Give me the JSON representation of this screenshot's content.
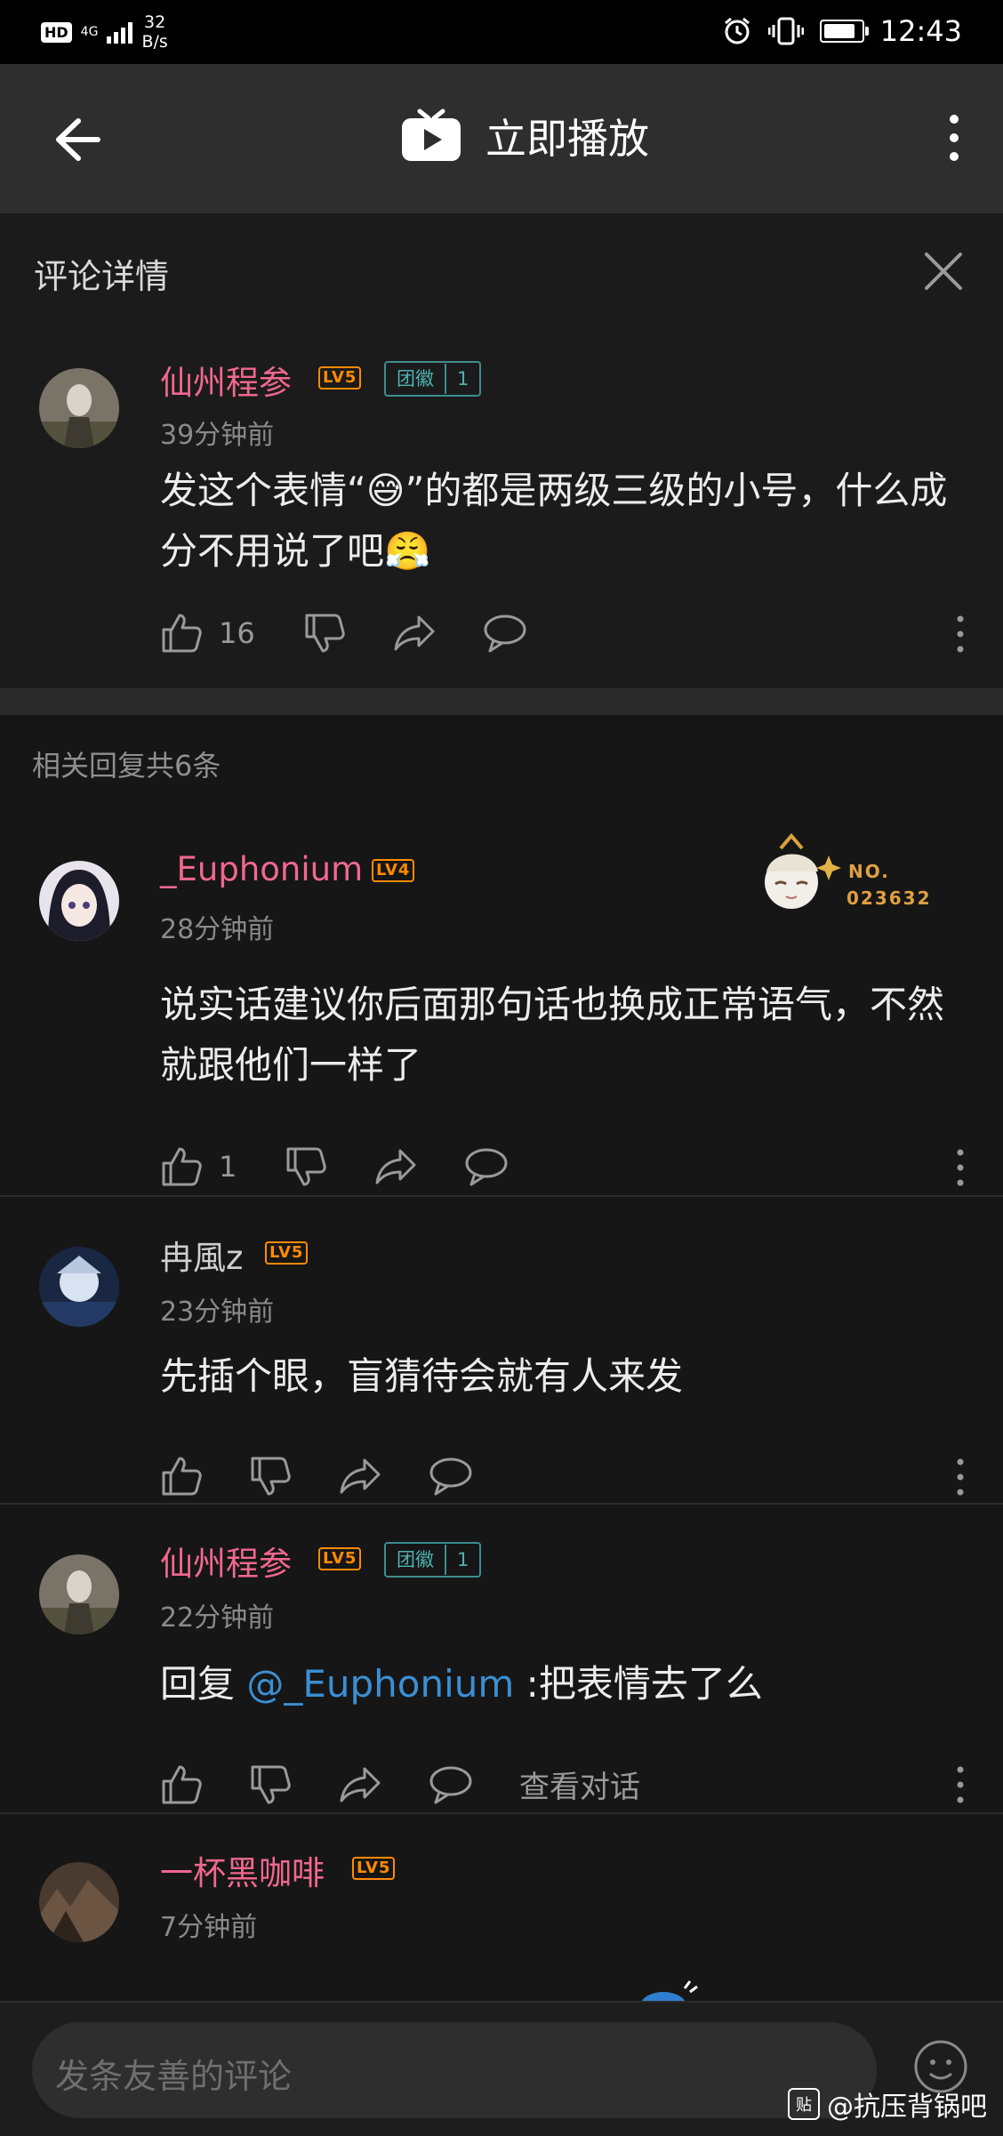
{
  "status_bar": {
    "hd": "HD",
    "network": "4G",
    "speed_value": "32",
    "speed_unit": "B/s",
    "time": "12:43",
    "battery_level": 0.85
  },
  "app_bar": {
    "title": "立即播放"
  },
  "sheet": {
    "title": "评论详情"
  },
  "main_comment": {
    "username": "仙州程参",
    "level": "LV5",
    "badge_label": "团徽",
    "badge_level": "1",
    "time": "39分钟前",
    "text_1": "发这个表情“",
    "emoji_1": "😅",
    "text_2": "”的都是两级三级的小号，什么成分不用说了吧",
    "emoji_2": "😤",
    "likes": "16"
  },
  "replies_header": "相关回复共6条",
  "replies": [
    {
      "username": "_Euphonium",
      "level": "LV4",
      "time": "28分钟前",
      "text": "说实话建议你后面那句话也换成正常语气，不然就跟他们一样了",
      "likes": "1",
      "pendant_label": "NO.",
      "pendant_number": "023632"
    },
    {
      "username": "冉風z",
      "level": "LV5",
      "time": "23分钟前",
      "text": "先插个眼，盲猜待会就有人来发"
    },
    {
      "username": "仙州程参",
      "level": "LV5",
      "badge_label": "团徽",
      "badge_level": "1",
      "time": "22分钟前",
      "prefix": "回复 ",
      "mention": "@_Euphonium",
      "text": " :把表情去了么",
      "view_conversation": "查看对话"
    },
    {
      "username": "一杯黑咖啡",
      "level": "LV5",
      "time": "7分钟前"
    }
  ],
  "input": {
    "placeholder": "发条友善的评论"
  },
  "watermark": {
    "icon": "贴",
    "text": "@抗压背锅吧"
  },
  "colors": {
    "username_pink": "#f0678f",
    "level_orange": "#ff8b00",
    "badge_teal": "#3d8d8e",
    "mention_blue": "#3b8fd3"
  }
}
